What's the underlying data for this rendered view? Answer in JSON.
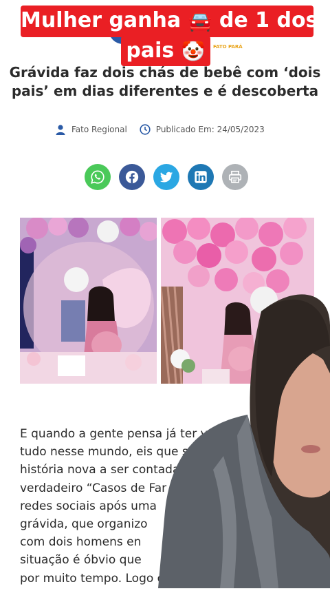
{
  "caption": {
    "line1_text": "Mulher ganha",
    "line1_suffix": "de 1 dos",
    "line2_text": "pais",
    "car_emoji": "🚘",
    "clown_emoji": "🤡"
  },
  "site": {
    "logo_tag": "FATO PARÁ"
  },
  "article": {
    "headline": "Grávida faz dois chás de bebê com ‘dois pais’ em dias diferentes e é descoberta",
    "author": "Fato Regional",
    "published": "Publicado Em: 24/05/2023",
    "share_buttons": [
      "whatsapp-icon",
      "facebook-icon",
      "twitter-icon",
      "linkedin-icon",
      "print-icon"
    ],
    "body_lines": [
      "E quando a gente pensa já ter v",
      "tudo nesse mundo, eis que s",
      "história nova a ser contada",
      "verdadeiro “Casos de Far",
      "redes sociais após uma",
      "grávida, que organizo",
      "com dois homens en",
      "situação é óbvio que",
      "por muito tempo. Logo o caso foi"
    ]
  },
  "colors": {
    "caption_red": "#ea1f24",
    "whatsapp": "#4ac959",
    "facebook": "#3b5998",
    "twitter": "#2ba7e3",
    "linkedin": "#1e78b4",
    "print": "#aeb2b6",
    "icon_blue": "#2a5aa6"
  }
}
